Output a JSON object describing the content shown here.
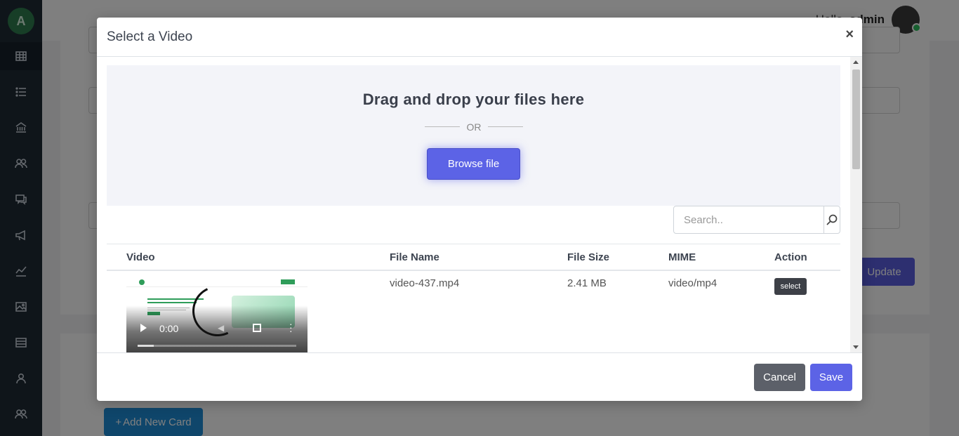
{
  "app": {
    "logo_glyph": "A",
    "greeting": "Hello,",
    "user_name": "admin",
    "update_label": "Update",
    "add_card_label": "Add New Card",
    "add_card_prefix": "+",
    "sidebar_icons": [
      "grid-icon",
      "list-icon",
      "bank-icon",
      "users-icon",
      "chat-icon",
      "megaphone-icon",
      "analytics-icon",
      "image-icon",
      "table-icon",
      "user-icon",
      "group-icon"
    ]
  },
  "modal": {
    "title": "Select a Video",
    "close_glyph": "×",
    "dropzone": {
      "title": "Drag and drop your files here",
      "or_text": "OR",
      "browse_label": "Browse file"
    },
    "search": {
      "placeholder": "Search.."
    },
    "table": {
      "headers": [
        "Video",
        "File Name",
        "File Size",
        "MIME",
        "Action"
      ],
      "rows": [
        {
          "file_name": "video-437.mp4",
          "file_size": "2.41 MB",
          "mime": "video/mp4",
          "action_label": "select",
          "player": {
            "time": "0:00",
            "progress": 0.1
          }
        }
      ]
    },
    "footer": {
      "cancel_label": "Cancel",
      "save_label": "Save"
    }
  },
  "colors": {
    "accent": "#5c63e6",
    "sidebar_bg": "#1e2a35",
    "dark_button": "#3d4047"
  }
}
